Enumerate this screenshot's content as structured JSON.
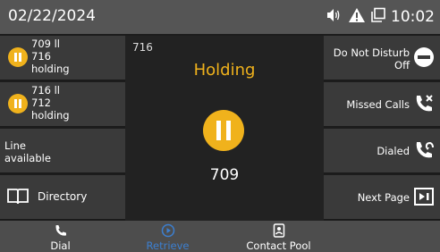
{
  "status_bar": {
    "date": "02/22/2024",
    "time": "10:02",
    "icons": [
      "speaker-icon",
      "warning-icon",
      "copy-icon"
    ]
  },
  "lines": [
    {
      "title": "709 ll",
      "number": "716",
      "state": "holding",
      "icon": "hold-icon"
    },
    {
      "title": "716 ll",
      "number": "712",
      "state": "holding",
      "icon": "hold-icon"
    },
    {
      "text1": "Line",
      "text2": "available"
    },
    {
      "label": "Directory",
      "icon": "book-icon"
    }
  ],
  "call": {
    "line_number": "716",
    "status": "Holding",
    "caller": "709",
    "status_color": "#f0b21c"
  },
  "right_keys": [
    {
      "label1": "Do Not Disturb",
      "label2": "Off",
      "icon": "dnd-icon"
    },
    {
      "label": "Missed Calls",
      "icon": "missed-call-icon"
    },
    {
      "label": "Dialed",
      "icon": "dialed-call-icon"
    },
    {
      "label": "Next Page",
      "icon": "next-page-icon"
    }
  ],
  "softkeys": [
    {
      "label": "Dial",
      "icon": "phone-icon"
    },
    {
      "label": "Retrieve",
      "icon": "play-icon",
      "disabled": true
    },
    {
      "label": "Contact Pool",
      "icon": "contact-icon"
    },
    {
      "label": ""
    }
  ]
}
